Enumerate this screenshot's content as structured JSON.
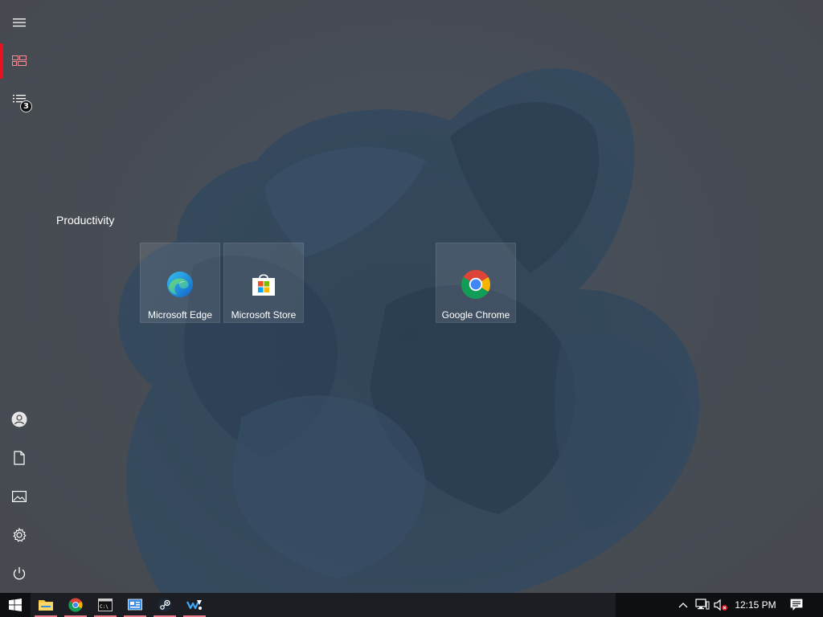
{
  "rail": {
    "menu_icon": "hamburger-menu-icon",
    "pinned_icon": "tiles-icon",
    "all_apps_icon": "list-icon",
    "notification_count": "3",
    "account_icon": "user-icon",
    "documents_icon": "document-icon",
    "pictures_icon": "pictures-icon",
    "settings_icon": "gear-icon",
    "power_icon": "power-icon",
    "accent_color": "#e81123"
  },
  "group": {
    "title": "Productivity",
    "tiles": [
      {
        "label": "Microsoft Edge",
        "icon": "edge-icon"
      },
      {
        "label": "Microsoft Store",
        "icon": "store-icon"
      },
      {
        "label": "Google Chrome",
        "icon": "chrome-icon"
      }
    ]
  },
  "taskbar": {
    "start_icon": "windows-logo-icon",
    "apps": [
      {
        "name": "File Explorer",
        "icon": "folder-icon"
      },
      {
        "name": "Google Chrome",
        "icon": "chrome-icon"
      },
      {
        "name": "Command Prompt",
        "icon": "terminal-icon"
      },
      {
        "name": "Control Panel",
        "icon": "control-panel-icon"
      },
      {
        "name": "Steam",
        "icon": "steam-icon"
      },
      {
        "name": "Visual Studio",
        "icon": "vs-icon"
      }
    ],
    "tray": {
      "chevron_icon": "chevron-up-icon",
      "network_icon": "network-icon",
      "volume_icon": "volume-muted-icon",
      "clock": "12:15 PM",
      "action_center_icon": "action-center-icon"
    }
  }
}
